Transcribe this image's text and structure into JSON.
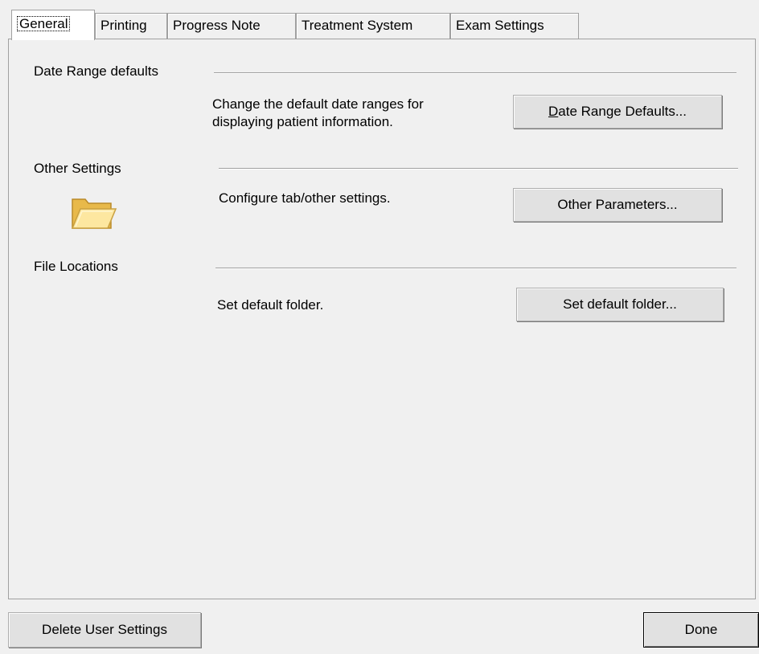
{
  "tabs": [
    "General",
    "Printing",
    "Progress Note",
    "Treatment System",
    "Exam Settings"
  ],
  "active_tab": "General",
  "sections": {
    "date_range": {
      "title": "Date Range defaults",
      "description_line1": "Change the default date ranges for",
      "description_line2": "displaying patient information.",
      "button_mnemonic": "D",
      "button_rest": "ate Range Defaults..."
    },
    "other_settings": {
      "title": "Other Settings",
      "icon": "folder-icon",
      "description": "Configure tab/other settings.",
      "button": "Other Parameters..."
    },
    "file_locations": {
      "title": "File Locations",
      "description": "Set default folder.",
      "button": "Set default folder..."
    }
  },
  "footer": {
    "delete_button": "Delete User Settings",
    "done_button": "Done"
  }
}
